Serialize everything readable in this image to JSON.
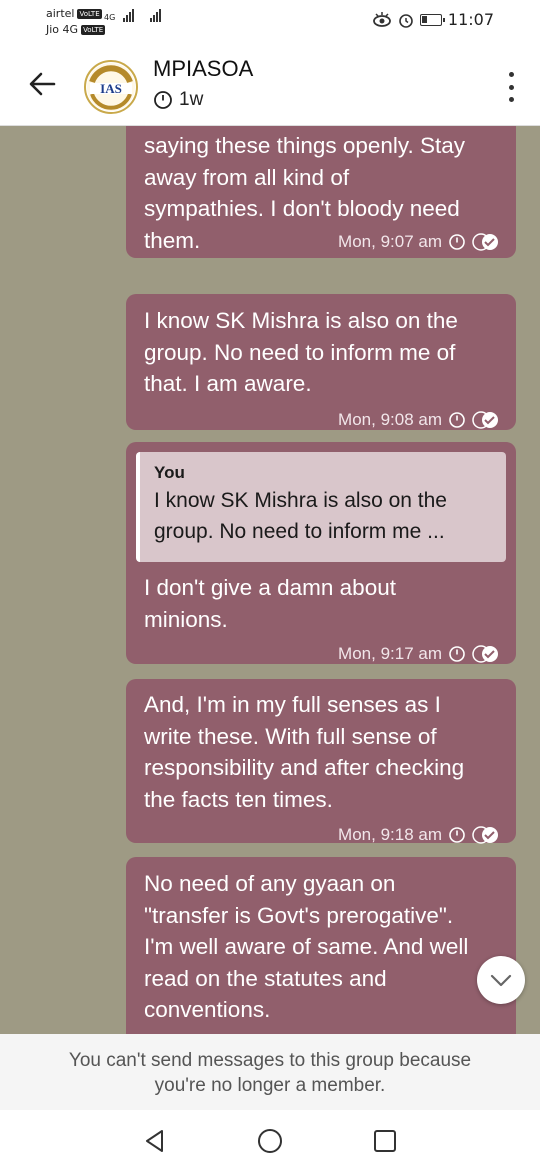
{
  "status_bar": {
    "carrier_1": "airtel",
    "carrier_2": "Jio 4G",
    "volte": "VoLTE",
    "network_type": "4G",
    "time": "11:07",
    "battery_level": 0.3
  },
  "header": {
    "title": "MPIASOA",
    "subtitle": "1w",
    "avatar_text": "IAS"
  },
  "messages": [
    {
      "text": "saying these things openly. Stay\naway from all kind of\nsympathies. I don't bloody need\nthem.",
      "time": "Mon, 9:07 am"
    },
    {
      "text": "I know SK Mishra is also on the\ngroup. No need to inform me of\nthat. I am aware.",
      "time": "Mon, 9:08 am"
    },
    {
      "quote_author": "You",
      "quote_text": "I know SK Mishra is also on the\ngroup. No need to inform me ...",
      "text": "I don't give a damn about\nminions.",
      "time": "Mon, 9:17 am"
    },
    {
      "text": "And, I'm in my full senses as I\nwrite these. With full sense of\nresponsibility and after checking\nthe facts ten times.",
      "time": "Mon, 9:18 am"
    },
    {
      "text": "No need of any gyaan on\n\"transfer is Govt's prerogative\".\nI'm well aware of same. And well\nread on the statutes and\nconventions.",
      "time": ""
    }
  ],
  "notice": {
    "line_1": "You can't send messages to this group because",
    "line_2": "you're no longer a member."
  },
  "colors": {
    "bubble": "#915f6c",
    "chat_bg": "#9e9a84",
    "quote_bg": "#d9c6cb"
  },
  "icons": {
    "back": "arrow-left-icon",
    "timer": "timer-icon",
    "menu": "more-vert-icon",
    "read": "double-check-icon",
    "scroll": "chevron-down-icon",
    "nav_back": "triangle-back-icon",
    "nav_home": "circle-home-icon",
    "nav_recents": "square-recents-icon"
  }
}
